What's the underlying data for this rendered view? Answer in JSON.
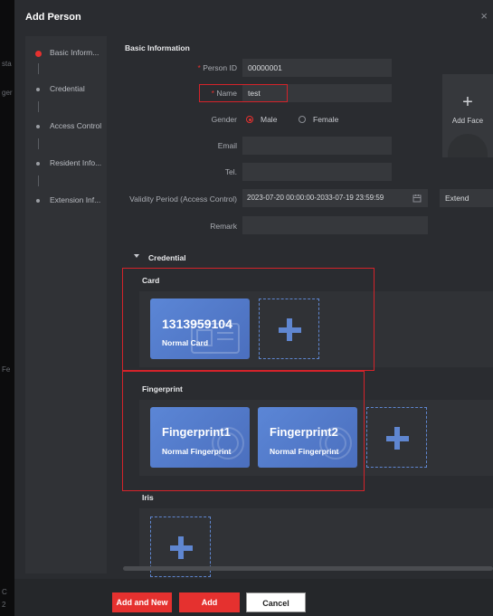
{
  "dialog": {
    "title": "Add Person",
    "close_icon": "×"
  },
  "edge": {
    "text1": "sta",
    "text2": "ger",
    "text3": "Fe",
    "text4": "C",
    "text5": "2"
  },
  "nav": {
    "items": [
      {
        "label": "Basic Inform..."
      },
      {
        "label": "Credential"
      },
      {
        "label": "Access Control"
      },
      {
        "label": "Resident Info..."
      },
      {
        "label": "Extension Inf..."
      }
    ]
  },
  "basic": {
    "title": "Basic Information",
    "person_id_label": "Person ID",
    "person_id_value": "00000001",
    "name_label": "Name",
    "name_value": "test",
    "required_mark": "*",
    "gender_label": "Gender",
    "male_label": "Male",
    "female_label": "Female",
    "email_label": "Email",
    "tel_label": "Tel.",
    "validity_label": "Validity Period (Access Control)",
    "validity_value": "2023-07-20 00:00:00-2033-07-19 23:59:59",
    "extend_label": "Extend",
    "remark_label": "Remark",
    "add_face_plus": "+",
    "add_face_label": "Add Face"
  },
  "credential": {
    "title": "Credential",
    "card_title": "Card",
    "card_number": "1313959104",
    "card_type": "Normal Card",
    "fingerprint_title": "Fingerprint",
    "fingerprints": [
      {
        "name": "Fingerprint1",
        "type": "Normal Fingerprint"
      },
      {
        "name": "Fingerprint2",
        "type": "Normal Fingerprint"
      }
    ],
    "iris_title": "Iris"
  },
  "footer": {
    "add_and_new": "Add and New",
    "add": "Add",
    "cancel": "Cancel"
  },
  "colors": {
    "accent": "#e5312f",
    "card_blue": "#5b86d6",
    "dashed_blue": "#5f86d0"
  }
}
